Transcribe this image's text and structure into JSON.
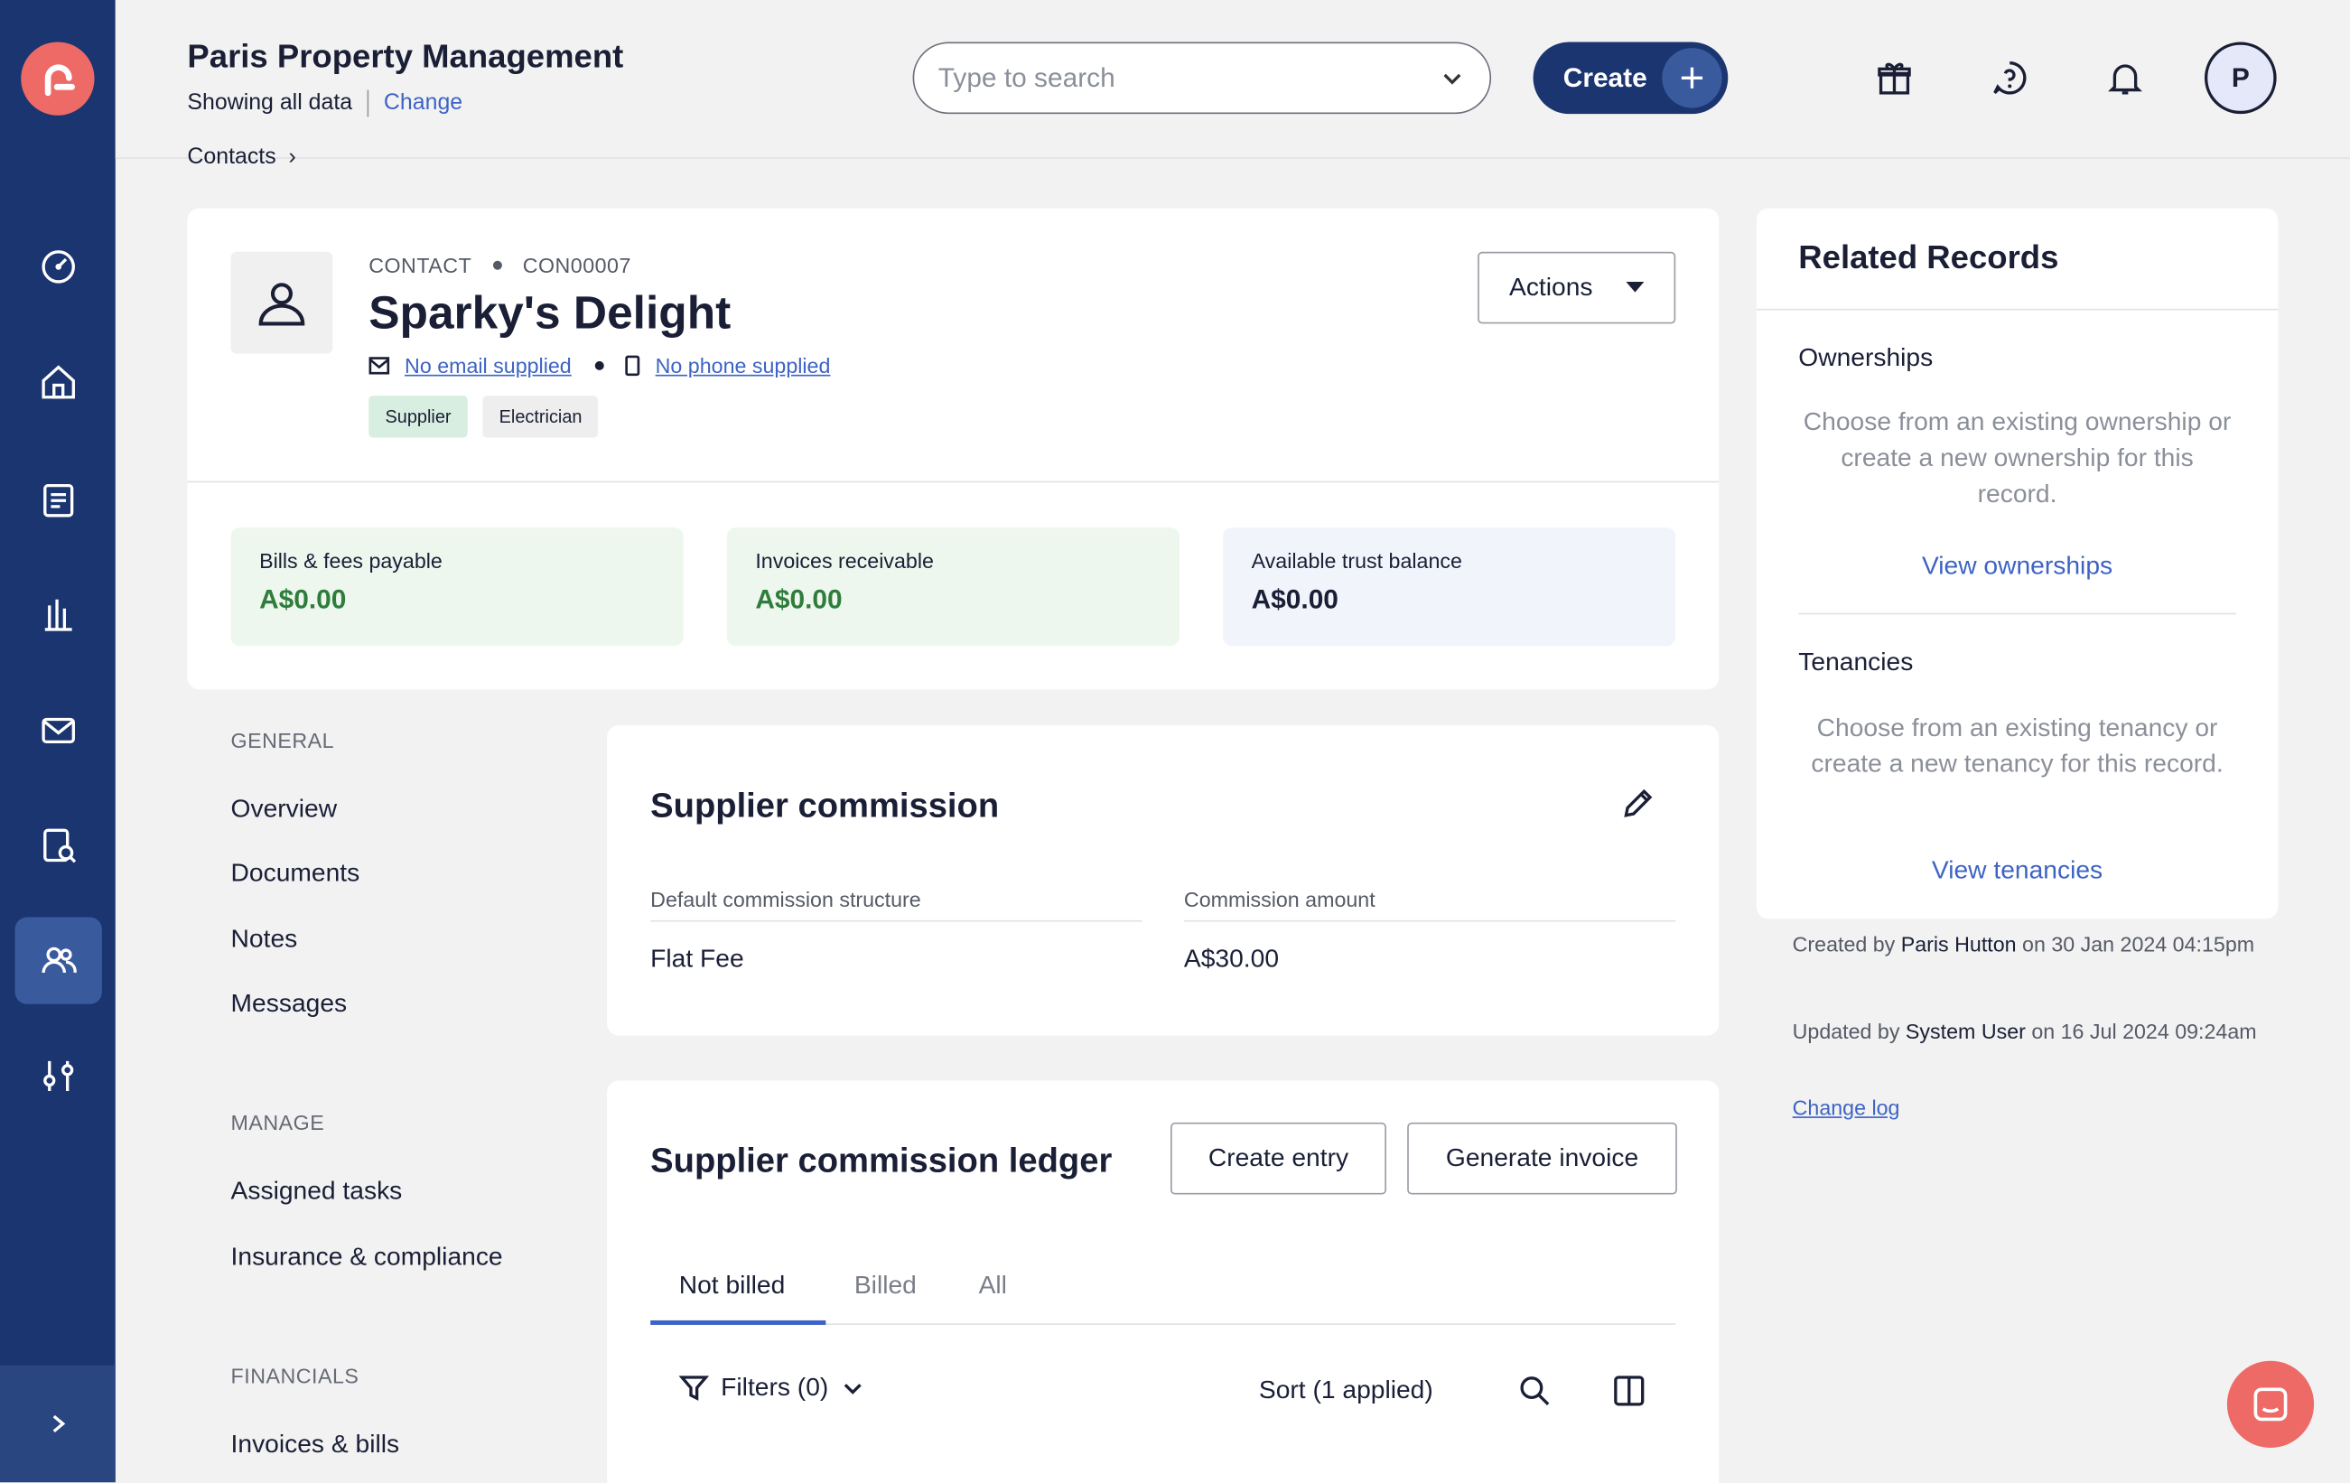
{
  "header": {
    "org_name": "Paris Property Management",
    "showing": "Showing all data",
    "change": "Change",
    "search_placeholder": "Type to search",
    "create_label": "Create",
    "avatar_initial": "P"
  },
  "breadcrumb": "Contacts",
  "contact": {
    "type": "CONTACT",
    "id": "CON00007",
    "name": "Sparky's Delight",
    "email": "No email supplied",
    "phone": "No phone supplied",
    "tags": [
      "Supplier",
      "Electrician"
    ],
    "actions": "Actions"
  },
  "stats": [
    {
      "label": "Bills & fees payable",
      "value": "A$0.00"
    },
    {
      "label": "Invoices receivable",
      "value": "A$0.00"
    },
    {
      "label": "Available trust balance",
      "value": "A$0.00"
    }
  ],
  "leftnav": {
    "general": "GENERAL",
    "general_items": [
      "Overview",
      "Documents",
      "Notes",
      "Messages"
    ],
    "manage": "MANAGE",
    "manage_items": [
      "Assigned tasks",
      "Insurance & compliance"
    ],
    "financials": "FINANCIALS",
    "financials_items": [
      "Invoices & bills"
    ]
  },
  "commission": {
    "title": "Supplier commission",
    "structure_label": "Default commission structure",
    "structure_value": "Flat Fee",
    "amount_label": "Commission amount",
    "amount_value": "A$30.00"
  },
  "ledger": {
    "title": "Supplier commission ledger",
    "create_entry": "Create entry",
    "generate_invoice": "Generate invoice",
    "tabs": [
      "Not billed",
      "Billed",
      "All"
    ],
    "filters": "Filters (0)",
    "sort": "Sort (1 applied)"
  },
  "related": {
    "title": "Related Records",
    "ownerships": "Ownerships",
    "ownerships_text": "Choose from an existing ownership or create a new ownership for this record.",
    "view_ownerships": "View ownerships",
    "tenancies": "Tenancies",
    "tenancies_text": "Choose from an existing tenancy or create a new tenancy for this record.",
    "view_tenancies": "View tenancies"
  },
  "meta": {
    "created_prefix": "Created by",
    "created_by": "Paris Hutton",
    "created_on": "on 30 Jan 2024 04:15pm",
    "updated_prefix": "Updated by",
    "updated_by": "System User",
    "updated_on": "on 16 Jul 2024 09:24am",
    "change_log": "Change log"
  },
  "colors": {
    "sidebar": "#1b3570",
    "brand": "#ee6a66",
    "link": "#3d63c4",
    "positive": "#2f7d3c"
  }
}
